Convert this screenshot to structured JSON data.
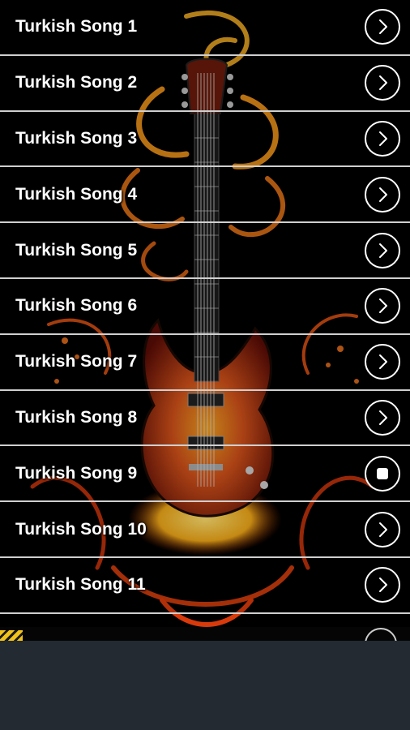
{
  "songs": [
    {
      "label": "Turkish Song 1",
      "state": "play"
    },
    {
      "label": "Turkish Song 2",
      "state": "play"
    },
    {
      "label": "Turkish Song 3",
      "state": "play"
    },
    {
      "label": "Turkish Song 4",
      "state": "play"
    },
    {
      "label": "Turkish Song 5",
      "state": "play"
    },
    {
      "label": "Turkish Song 6",
      "state": "play"
    },
    {
      "label": "Turkish Song 7",
      "state": "play"
    },
    {
      "label": "Turkish Song 8",
      "state": "play"
    },
    {
      "label": "Turkish Song 9",
      "state": "stop"
    },
    {
      "label": "Turkish Song 10",
      "state": "play"
    },
    {
      "label": "Turkish Song 11",
      "state": "play"
    }
  ],
  "icons": {
    "play": "chevron-right-icon",
    "stop": "stop-icon"
  },
  "colors": {
    "background": "#000000",
    "row_divider": "#cfcfcf",
    "text": "#ffffff",
    "bottom_panel": "#232a31"
  }
}
